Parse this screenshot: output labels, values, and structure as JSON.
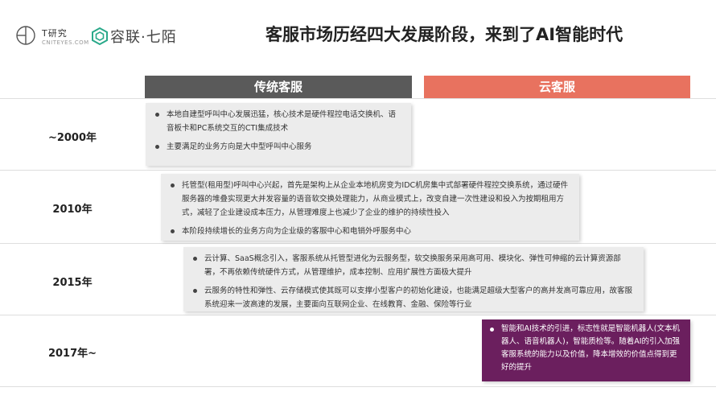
{
  "header": {
    "logo_t_text": "T研究",
    "logo_t_sub": "CNITEYES.COM",
    "logo_ronglian_text": "容联·七陌",
    "title": "客服市场历经四大发展阶段，来到了AI智能时代"
  },
  "columns": {
    "traditional": "传统客服",
    "cloud": "云客服"
  },
  "rows": [
    {
      "year": "~2000年",
      "bullets": [
        "本地自建型呼叫中心发展迅猛，核心技术是硬件程控电话交换机、语音板卡和PC系统交互的CTI集成技术",
        "主要满足的业务方向是大中型呼叫中心服务"
      ]
    },
    {
      "year": "2010年",
      "bullets": [
        "托管型(租用型)呼叫中心兴起，首先是架构上从企业本地机房变为IDC机房集中式部署硬件程控交换系统，通过硬件服务器的堆叠实现更大并发容量的语音软交换处理能力，从商业模式上，改变自建一次性建设和投入为按期租用方式，减轻了企业建设成本压力，从管理难度上也减少了企业的维护的持续性投入",
        "本阶段持续增长的业务方向为企业级的客服中心和电销外呼服务中心"
      ]
    },
    {
      "year": "2015年",
      "bullets": [
        "云计算、SaaS概念引入，客服系统从托管型进化为云服务型，软交换服务采用高可用、模块化、弹性可伸缩的云计算资源部署，不再依赖传统硬件方式，从管理维护，成本控制、应用扩展性方面极大提升",
        "云服务的特性和弹性、云存储模式使其既可以支撑小型客户的初始化建设，也能满足超级大型客户的高并发高可靠应用，故客服系统迎来一波高速的发展，主要面向互联网企业、在线教育、金融、保险等行业"
      ]
    },
    {
      "year": "2017年~",
      "bullets": [
        "智能和AI技术的引进，标志性就是智能机器人(文本机器人、语音机器人)，智能质检等。随着AI的引入加强客服系统的能力以及价值，降本增效的价值点得到更好的提升"
      ]
    }
  ],
  "colors": {
    "traditional_header": "#5a5a5a",
    "cloud_header": "#e8725f",
    "ai_box": "#6b1f5e",
    "box_gray": "#ececec"
  }
}
